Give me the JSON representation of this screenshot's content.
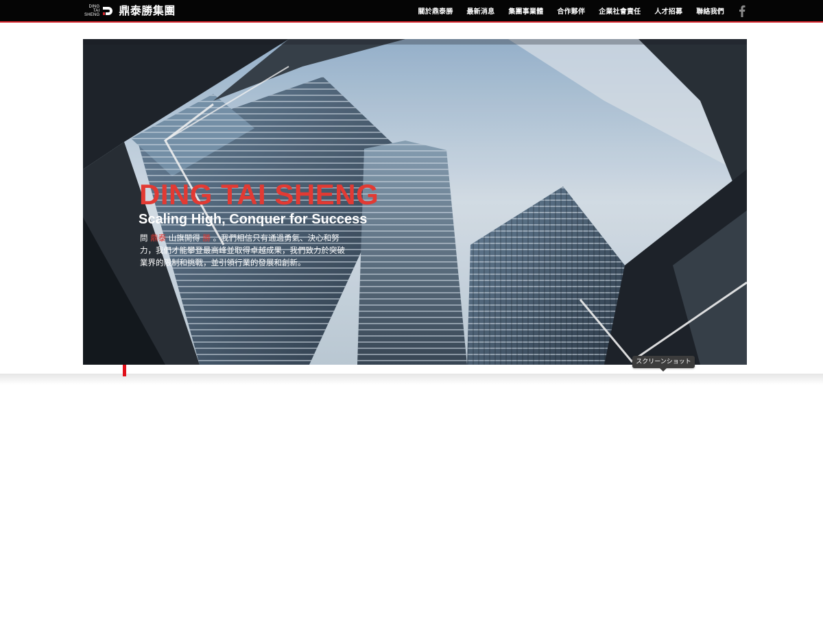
{
  "header": {
    "logo_small_lines": [
      "DING",
      "TAI",
      "SHENG"
    ],
    "logo_name": "鼎泰勝集團",
    "nav_items": [
      "關於鼎泰勝",
      "最新消息",
      "集團事業體",
      "合作夥伴",
      "企業社會責任",
      "人才招募",
      "聯絡我們"
    ],
    "social_icon": "facebook-icon",
    "accent_color": "#d8262d"
  },
  "hero": {
    "title": "DING TAI SHENG",
    "subtitle": "Scaling High, Conquer for Success",
    "body_parts": [
      "問 ",
      "鼎泰",
      " 山旗開得 ",
      "勝",
      " 。我們相信只有通過勇氣、決心和努力，我們才能攀登最高峰並取得卓越成果，我們致力於突破業界的限制和挑戰，並引領行業的發展和創新。"
    ],
    "title_color": "#e23a33"
  },
  "tooltip": {
    "label": "スクリーンショット"
  }
}
